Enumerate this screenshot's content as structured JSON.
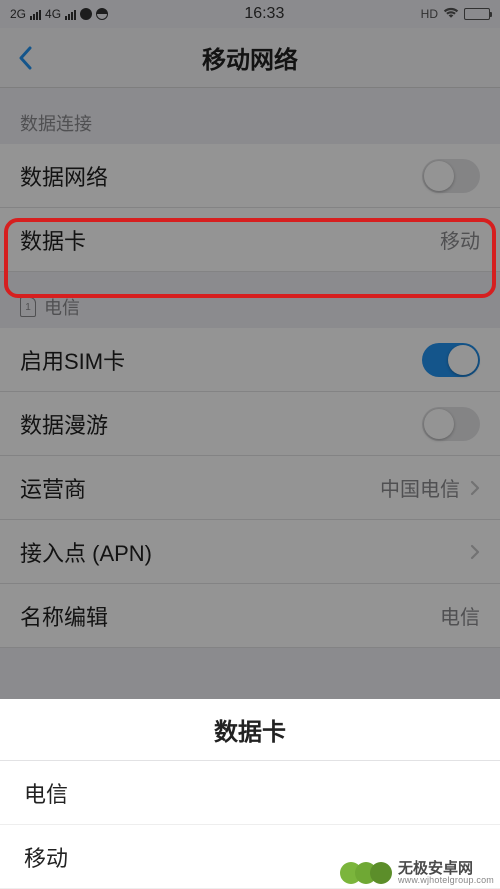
{
  "statusbar": {
    "net1": "2G",
    "net2": "4G",
    "time": "16:33",
    "hd": "HD"
  },
  "nav": {
    "title": "移动网络"
  },
  "section1": {
    "header": "数据连接",
    "mobile_data_label": "数据网络",
    "data_card_label": "数据卡",
    "data_card_value": "移动"
  },
  "section2": {
    "sim_num": "1",
    "sim_name": "电信",
    "enable_sim_label": "启用SIM卡",
    "roaming_label": "数据漫游",
    "carrier_label": "运营商",
    "carrier_value": "中国电信",
    "apn_label": "接入点 (APN)",
    "name_edit_label": "名称编辑",
    "name_edit_value": "电信"
  },
  "sheet": {
    "title": "数据卡",
    "options": [
      "电信",
      "移动"
    ]
  },
  "watermark": {
    "line1": "无极安卓网",
    "line2": "www.wjhotelgroup.com"
  }
}
